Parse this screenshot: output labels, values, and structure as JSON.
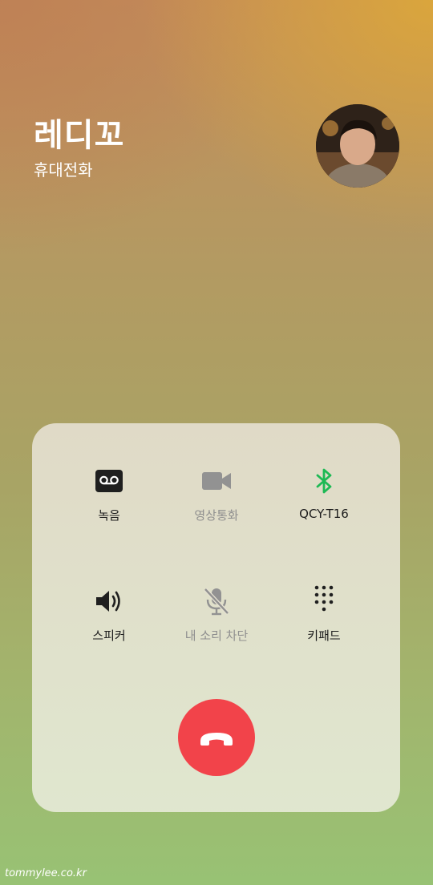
{
  "caller": {
    "name": "레디꼬",
    "type": "휴대전화",
    "avatar_icon": "user-photo-avatar"
  },
  "controls": {
    "record": {
      "label": "녹음",
      "icon": "voicemail-tape-icon",
      "enabled": true
    },
    "video_call": {
      "label": "영상통화",
      "icon": "video-camera-icon",
      "enabled": false
    },
    "bluetooth": {
      "label": "QCY-T16",
      "icon": "bluetooth-icon",
      "enabled": true,
      "color": "#1db954"
    },
    "speaker": {
      "label": "스피커",
      "icon": "speaker-volume-icon",
      "enabled": true
    },
    "mute": {
      "label": "내 소리 차단",
      "icon": "mic-off-icon",
      "enabled": false
    },
    "keypad": {
      "label": "키패드",
      "icon": "dialpad-icon",
      "enabled": true
    }
  },
  "end_call": {
    "icon": "hang-up-phone-icon",
    "color": "#f2434a"
  },
  "watermark": "tommylee.co.kr"
}
